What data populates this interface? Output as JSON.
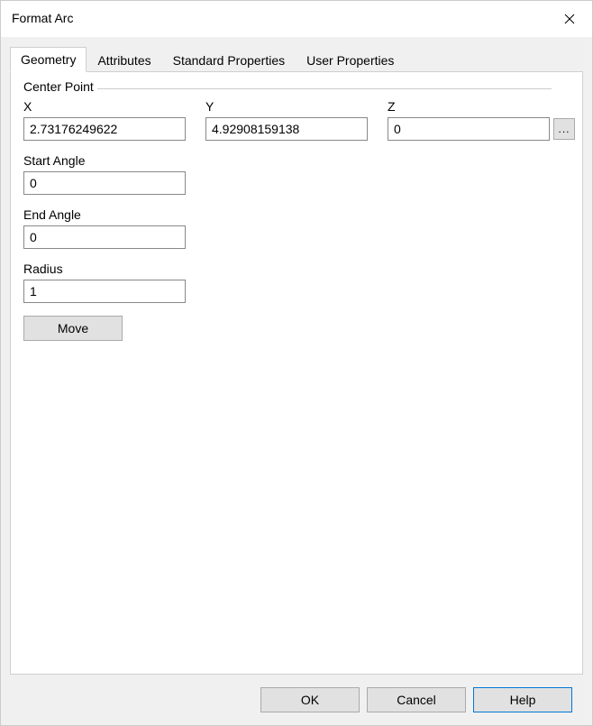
{
  "window": {
    "title": "Format Arc"
  },
  "tabs": [
    {
      "label": "Geometry",
      "active": true
    },
    {
      "label": "Attributes",
      "active": false
    },
    {
      "label": "Standard Properties",
      "active": false
    },
    {
      "label": "User Properties",
      "active": false
    }
  ],
  "geometry": {
    "legend": "Center Point",
    "x_label": "X",
    "y_label": "Y",
    "z_label": "Z",
    "x_value": "2.73176249622",
    "y_value": "4.92908159138",
    "z_value": "0",
    "browse_label": "...",
    "start_angle_label": "Start Angle",
    "start_angle_value": "0",
    "end_angle_label": "End Angle",
    "end_angle_value": "0",
    "radius_label": "Radius",
    "radius_value": "1",
    "move_label": "Move"
  },
  "footer": {
    "ok": "OK",
    "cancel": "Cancel",
    "help": "Help"
  }
}
